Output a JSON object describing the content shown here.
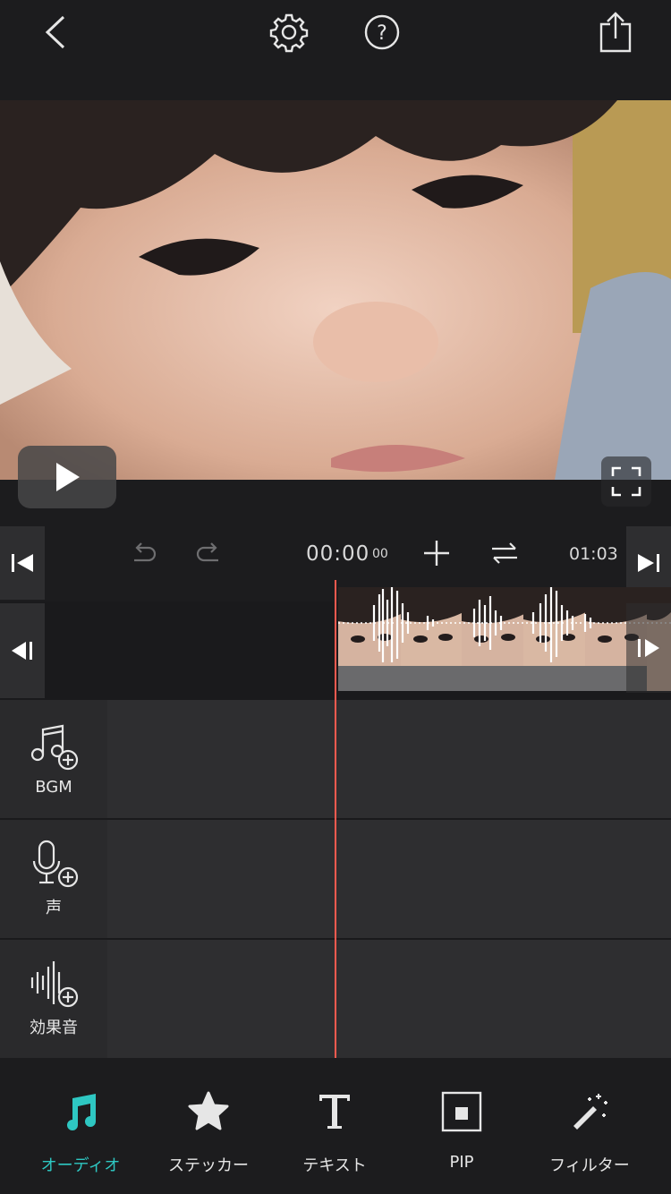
{
  "colors": {
    "accent": "#2ec7c2",
    "playhead": "#ff5a4f",
    "background": "#1c1c1e"
  },
  "header": {
    "back_icon": "chevron-left-icon",
    "settings_icon": "gear-icon",
    "help_icon": "question-circle-icon",
    "share_icon": "share-icon"
  },
  "preview": {
    "play_icon": "play-icon",
    "fullscreen_icon": "fullscreen-icon"
  },
  "transport": {
    "current_time": "00:00",
    "current_frames": "00",
    "total_time": "01:03"
  },
  "audio_tracks": [
    {
      "label": "BGM",
      "icon": "music-add-icon"
    },
    {
      "label": "声",
      "icon": "mic-add-icon"
    },
    {
      "label": "効果音",
      "icon": "sound-effect-add-icon"
    }
  ],
  "tabs": [
    {
      "label": "オーディオ",
      "icon": "music-note-icon",
      "active": true
    },
    {
      "label": "ステッカー",
      "icon": "star-icon",
      "active": false
    },
    {
      "label": "テキスト",
      "icon": "text-icon",
      "active": false
    },
    {
      "label": "PIP",
      "icon": "pip-icon",
      "active": false
    },
    {
      "label": "フィルター",
      "icon": "magic-wand-icon",
      "active": false
    }
  ]
}
